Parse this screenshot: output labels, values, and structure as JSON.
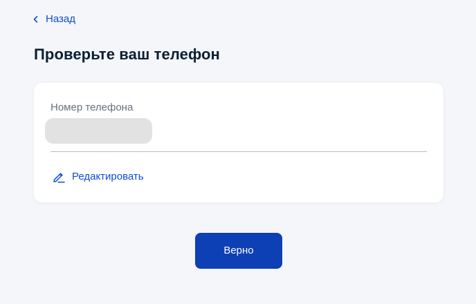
{
  "nav": {
    "back_label": "Назад",
    "back_icon": "chevron-left-icon"
  },
  "page": {
    "title": "Проверьте ваш телефон"
  },
  "card": {
    "field_label": "Номер телефона",
    "phone_value": "",
    "edit_label": "Редактировать",
    "edit_icon": "pencil-icon"
  },
  "actions": {
    "confirm_label": "Верно"
  },
  "colors": {
    "background": "#f4f6fa",
    "link": "#0d4cd3",
    "primary_button": "#0d3fb5",
    "title_text": "#0b1f33",
    "label_text": "#66727f",
    "divider": "#b3bcc6",
    "masked_value": "#e2e2e3"
  }
}
